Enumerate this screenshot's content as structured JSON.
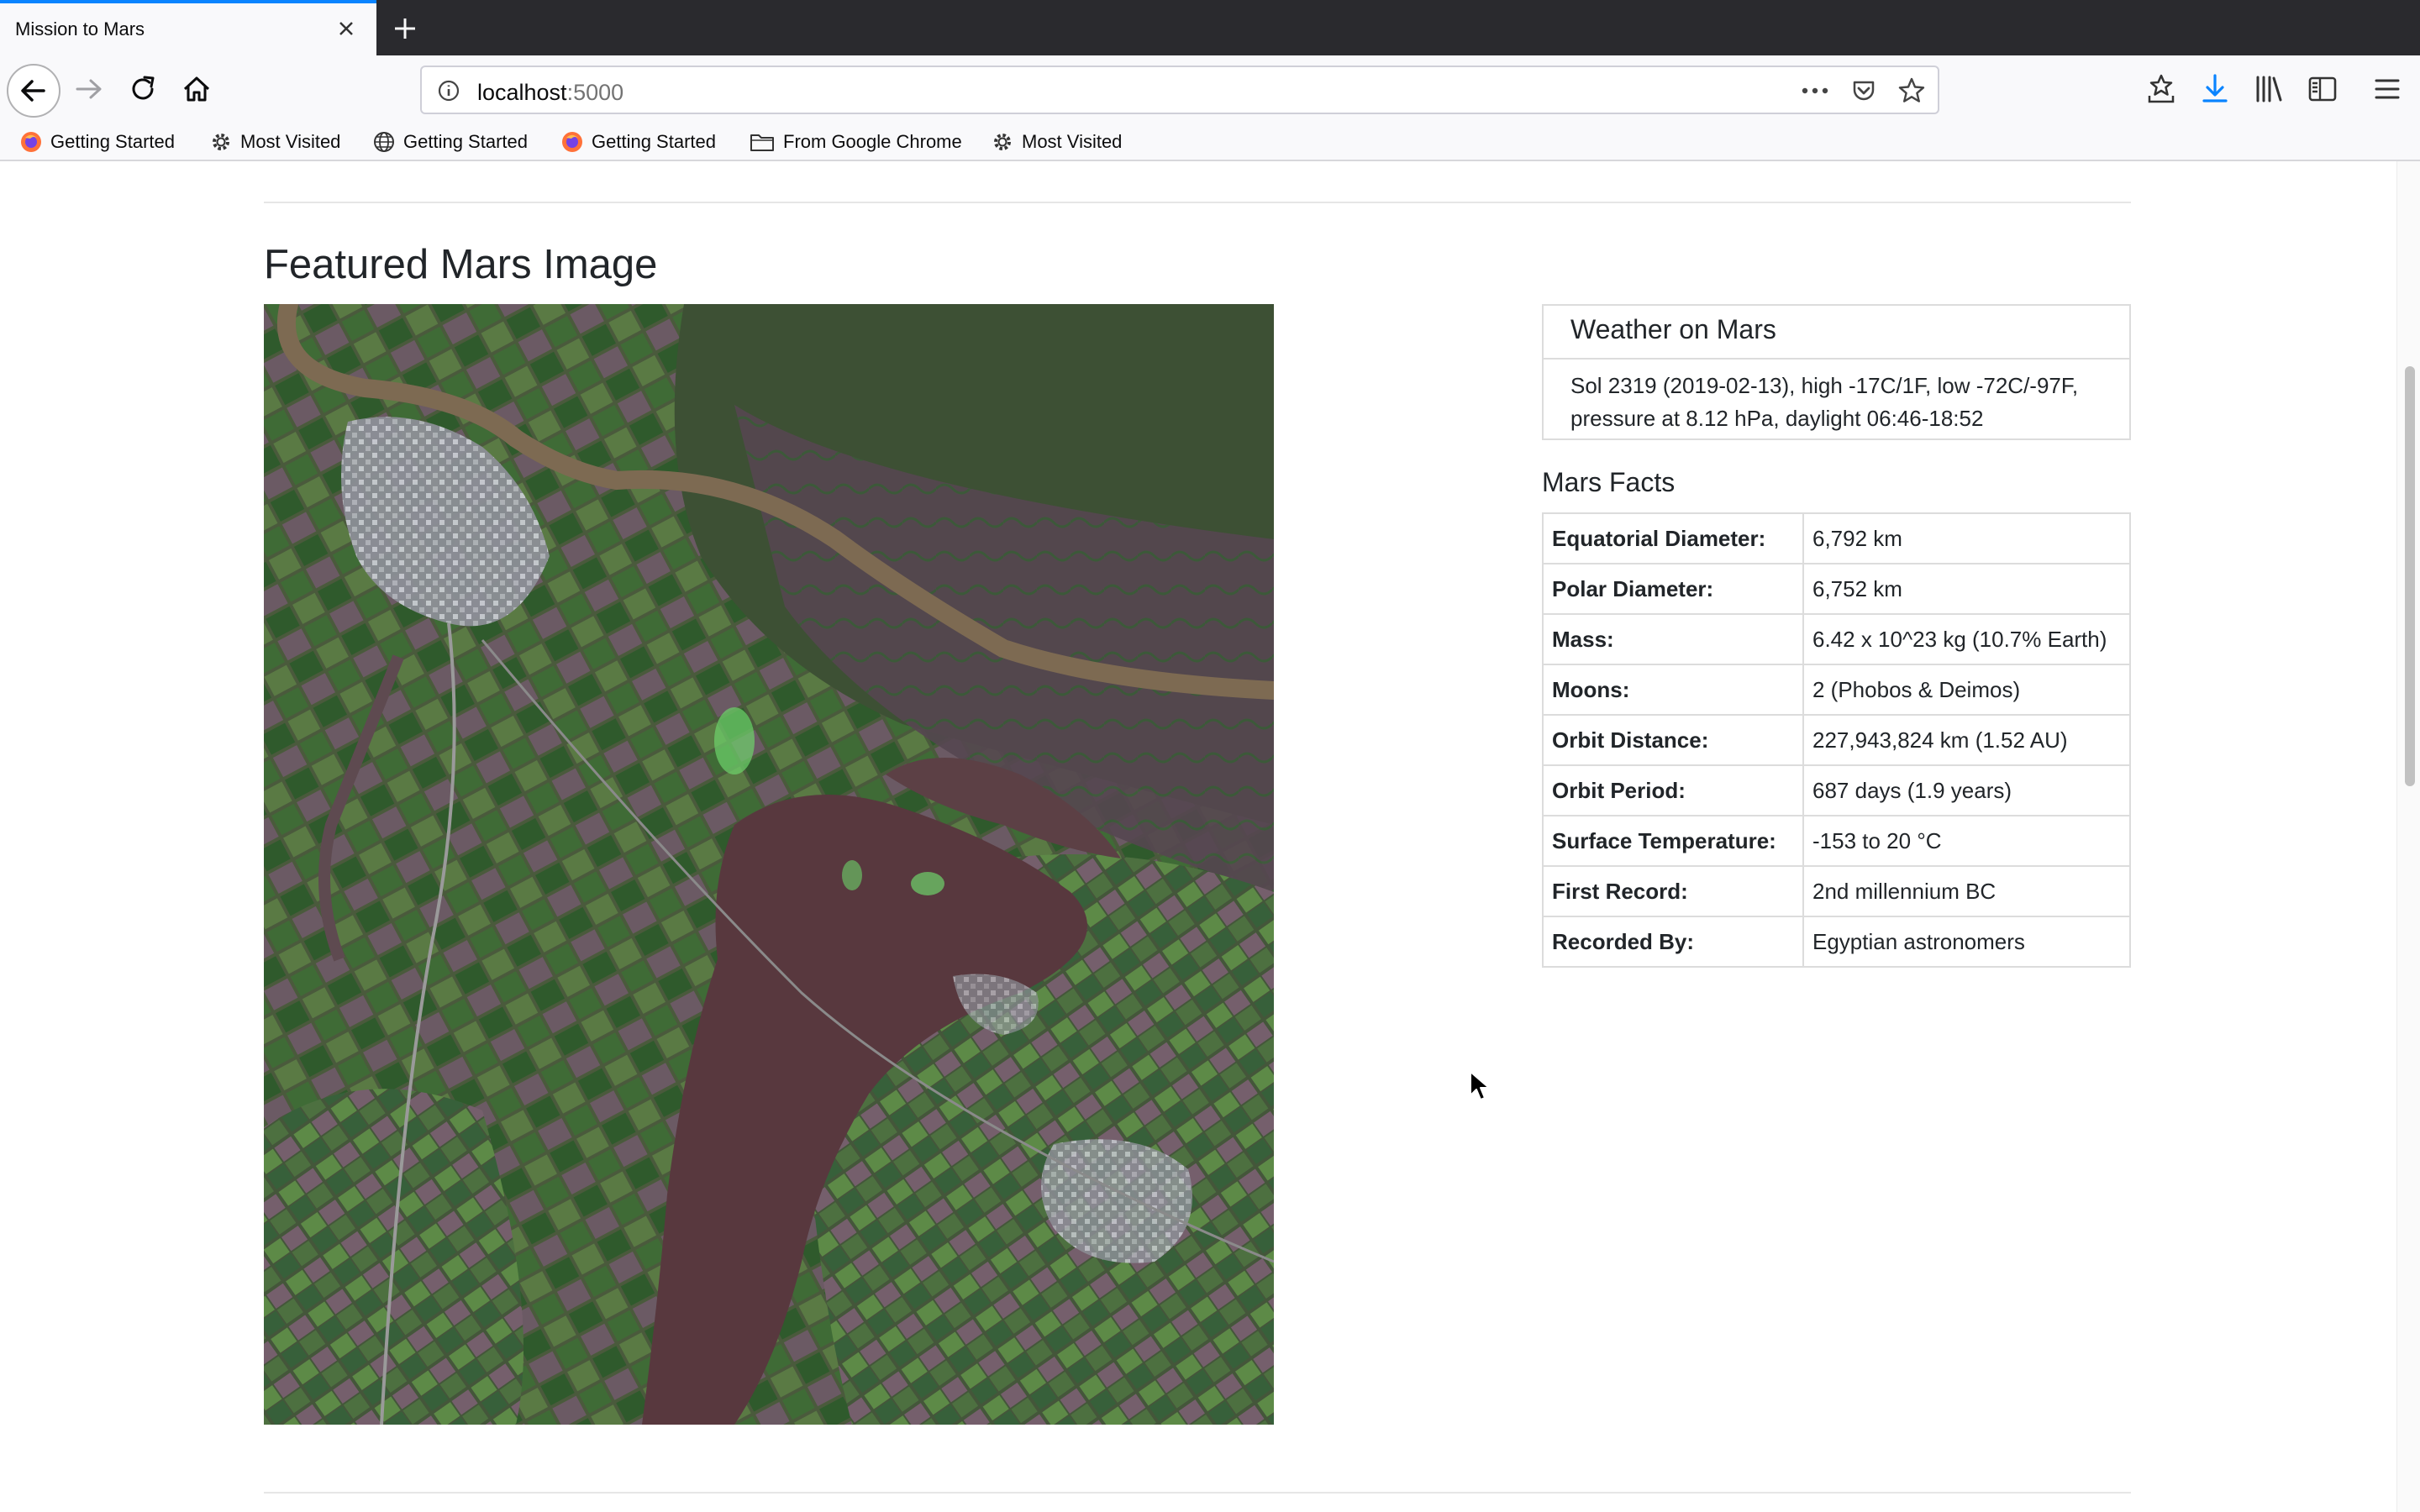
{
  "browser": {
    "tab_title": "Mission to Mars",
    "url_host": "localhost",
    "url_port": ":5000",
    "bookmarks": [
      {
        "label": "Getting Started",
        "icon": "firefox-icon"
      },
      {
        "label": "Most Visited",
        "icon": "gear-icon"
      },
      {
        "label": "Getting Started",
        "icon": "globe-icon"
      },
      {
        "label": "Getting Started",
        "icon": "firefox-icon"
      },
      {
        "label": "From Google Chrome",
        "icon": "folder-icon"
      },
      {
        "label": "Most Visited",
        "icon": "gear-icon"
      }
    ]
  },
  "featured": {
    "heading": "Featured Mars Image"
  },
  "weather": {
    "title": "Weather on Mars",
    "text": "Sol 2319 (2019-02-13), high -17C/1F, low -72C/-97F, pressure at 8.12 hPa, daylight 06:46-18:52"
  },
  "facts": {
    "title": "Mars Facts",
    "rows": [
      {
        "label": "Equatorial Diameter:",
        "value": "6,792 km"
      },
      {
        "label": "Polar Diameter:",
        "value": "6,752 km"
      },
      {
        "label": "Mass:",
        "value": "6.42 x 10^23 kg (10.7% Earth)"
      },
      {
        "label": "Moons:",
        "value": "2 (Phobos & Deimos)"
      },
      {
        "label": "Orbit Distance:",
        "value": "227,943,824 km (1.52 AU)"
      },
      {
        "label": "Orbit Period:",
        "value": "687 days (1.9 years)"
      },
      {
        "label": "Surface Temperature:",
        "value": "-153 to 20 °C"
      },
      {
        "label": "First Record:",
        "value": "2nd millennium BC"
      },
      {
        "label": "Recorded By:",
        "value": "Egyptian astronomers"
      }
    ]
  },
  "colors": {
    "tabstrip": "#2a2a2e",
    "active_tab_accent": "#0a84ff",
    "download_icon": "#0a84ff"
  }
}
